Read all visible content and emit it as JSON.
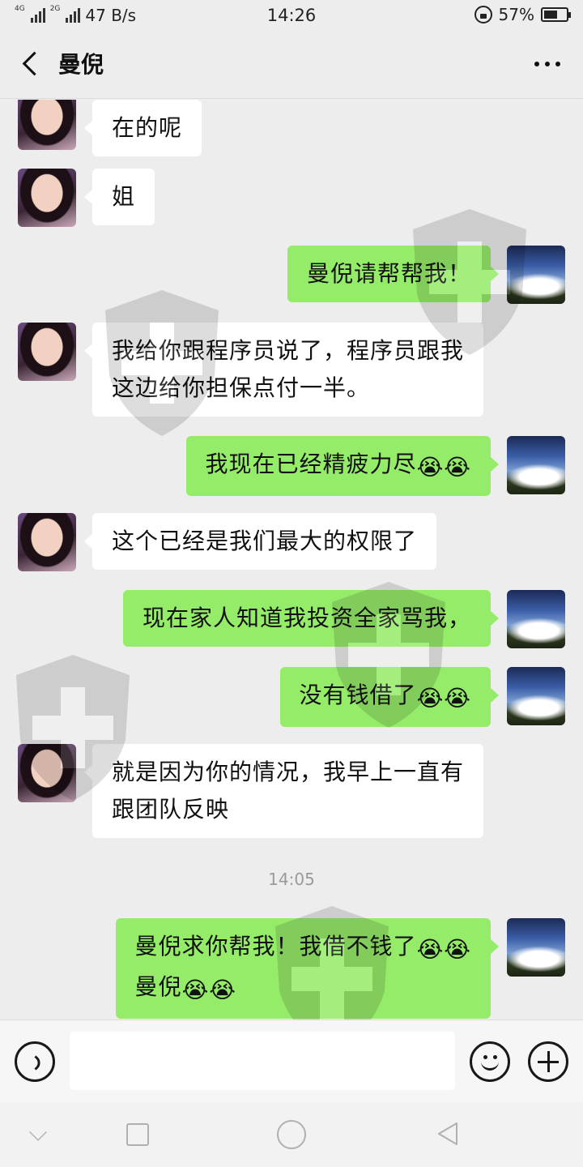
{
  "status_bar": {
    "network_tags": [
      "4G",
      "2G"
    ],
    "speed": "47 B/s",
    "time": "14:26",
    "battery": "57%"
  },
  "nav": {
    "title": "曼倪"
  },
  "messages": [
    {
      "from": "them",
      "text": "在的呢"
    },
    {
      "from": "them",
      "text": "姐"
    },
    {
      "from": "me",
      "text": "曼倪请帮帮我！"
    },
    {
      "from": "them",
      "line1": "我给你跟程序员说了，程序员跟我",
      "line2": "这边给你担保点付一半。"
    },
    {
      "from": "me",
      "text": "我现在已经精疲力尽",
      "emoji": "😭😭"
    },
    {
      "from": "them",
      "text": "这个已经是我们最大的权限了"
    },
    {
      "from": "me",
      "text": "现在家人知道我投资全家骂我，"
    },
    {
      "from": "me",
      "text": "没有钱借了",
      "emoji": "😭😭"
    },
    {
      "from": "them",
      "line1": "就是因为你的情况，我早上一直有",
      "line2": "跟团队反映"
    },
    {
      "from": "me",
      "line1": "曼倪求你帮我！我借不钱了",
      "line1_emoji": "😭😭",
      "line2": "曼倪",
      "line2_emoji": "😭😭"
    }
  ],
  "timestamp": "14:05",
  "colors": {
    "background": "#ededed",
    "my_bubble": "#95ec69",
    "their_bubble": "#ffffff"
  },
  "icons": [
    "back-icon",
    "more-icon",
    "voice-icon",
    "emoji-icon",
    "plus-icon",
    "lock-icon",
    "battery-icon"
  ]
}
